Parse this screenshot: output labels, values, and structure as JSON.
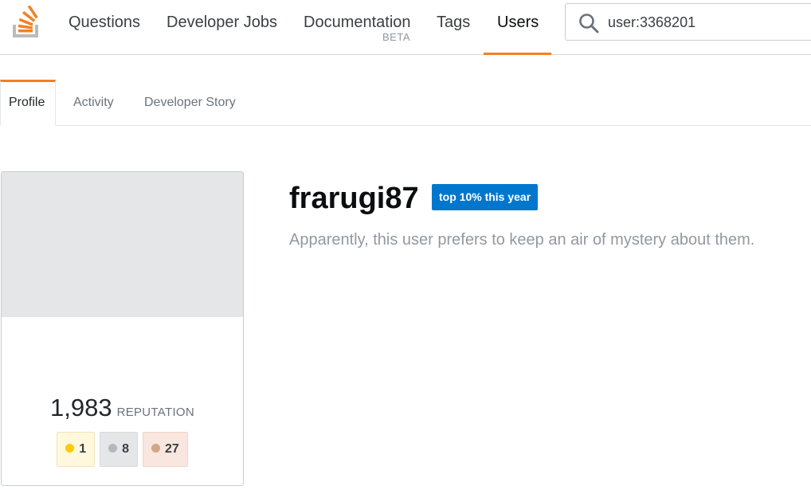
{
  "nav": {
    "items": [
      {
        "label": "Questions"
      },
      {
        "label": "Developer Jobs"
      },
      {
        "label": "Documentation",
        "sub": "BETA"
      },
      {
        "label": "Tags"
      },
      {
        "label": "Users"
      }
    ]
  },
  "search": {
    "value": "user:3368201"
  },
  "tabs": [
    {
      "label": "Profile"
    },
    {
      "label": "Activity"
    },
    {
      "label": "Developer Story"
    }
  ],
  "profile": {
    "username": "frarugi87",
    "top_badge": "top 10% this year",
    "bio": "Apparently, this user prefers to keep an air of mystery about them.",
    "reputation": "1,983",
    "reputation_label": "REPUTATION",
    "badges": {
      "gold": "1",
      "silver": "8",
      "bronze": "27"
    }
  },
  "colors": {
    "accent": "#f48024",
    "badge_blue": "#0077cc",
    "gold": "#ffcc01",
    "silver": "#b4b8bc",
    "bronze": "#d1a684"
  }
}
